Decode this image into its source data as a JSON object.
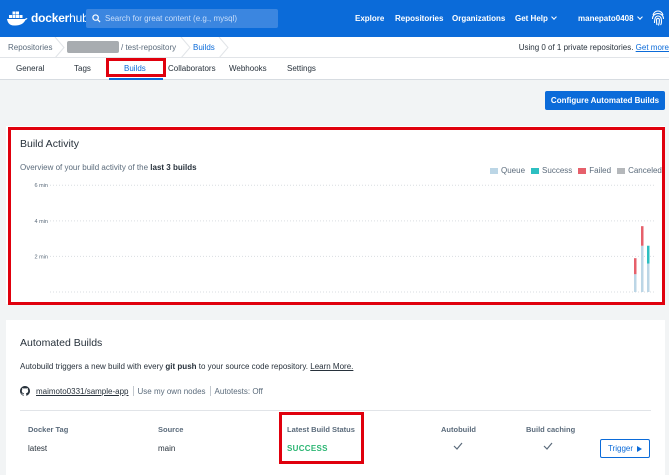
{
  "header": {
    "logo_text_bold": "docker",
    "logo_text_light": "hub",
    "search_placeholder": "Search for great content (e.g., mysql)",
    "nav": {
      "explore": "Explore",
      "repositories": "Repositories",
      "organizations": "Organizations",
      "help": "Get Help",
      "user": "manepato0408"
    }
  },
  "breadcrumb": {
    "root": "Repositories",
    "repo": "/ test-repository",
    "current": "Builds",
    "usage_text": "Using 0 of 1 private repositories.",
    "usage_link": "Get more"
  },
  "tabs": [
    "General",
    "Tags",
    "Builds",
    "Collaborators",
    "Webhooks",
    "Settings"
  ],
  "actions": {
    "configure_button": "Configure Automated Builds"
  },
  "activity": {
    "title": "Build Activity",
    "overview_prefix": "Overview of your build activity of the",
    "overview_bold": "last 3 builds",
    "legend": [
      {
        "label": "Queue",
        "color": "#bcd6e6"
      },
      {
        "label": "Success",
        "color": "#2dbfc1"
      },
      {
        "label": "Failed",
        "color": "#e6606b"
      },
      {
        "label": "Canceled",
        "color": "#b5b8bb"
      }
    ]
  },
  "chart_data": {
    "type": "bar",
    "stacked": true,
    "y_ticks": [
      "6 min",
      "4 min",
      "2 min"
    ],
    "ylim": [
      0,
      6.8
    ],
    "grid": true,
    "legend_placement": "top-right",
    "builds": [
      {
        "queue": 1.0,
        "success": 0,
        "failed": 0.9,
        "canceled": 0
      },
      {
        "queue": 2.6,
        "success": 0,
        "failed": 1.1,
        "canceled": 0
      },
      {
        "queue": 1.6,
        "success": 1.0,
        "failed": 0,
        "canceled": 0
      }
    ]
  },
  "automated": {
    "title": "Automated Builds",
    "desc_prefix": "Autobuild triggers a new build with every",
    "desc_bold": "git push",
    "desc_suffix": "to your source code repository.",
    "learn_more": "Learn More.",
    "repo_link": "maimoto0331/sample-app",
    "nodes": "Use my own nodes",
    "autotests": "Autotests: Off",
    "columns": {
      "tag": "Docker Tag",
      "source": "Source",
      "status": "Latest Build Status",
      "autobuild": "Autobuild",
      "caching": "Build caching"
    },
    "row": {
      "tag": "latest",
      "source": "main",
      "status": "SUCCESS",
      "trigger": "Trigger"
    }
  }
}
